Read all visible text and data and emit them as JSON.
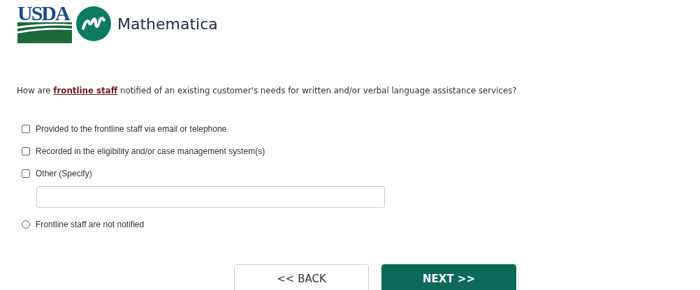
{
  "logos": {
    "usda": "USDA",
    "partner": "Mathematica"
  },
  "question": {
    "before": "How are ",
    "link": "frontline staff",
    "after": " notified of an existing customer's needs for written and/or verbal language assistance services?"
  },
  "options": [
    {
      "kind": "checkbox",
      "label": "Provided to the frontline staff via email or telephone",
      "checked": false
    },
    {
      "kind": "checkbox",
      "label": "Recorded in the eligibility and/or case management system(s)",
      "checked": false
    },
    {
      "kind": "checkbox_specify",
      "label": "Other (Specify)",
      "checked": false
    },
    {
      "kind": "radio",
      "label": "Frontline staff are not notified",
      "checked": false
    }
  ],
  "buttons": [
    {
      "kind": "secondary",
      "label": "<< BACK"
    },
    {
      "kind": "primary",
      "label": "NEXT >>"
    }
  ]
}
